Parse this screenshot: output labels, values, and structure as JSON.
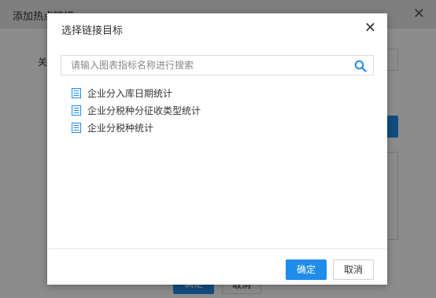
{
  "outer_dialog": {
    "title": "添加热点链接",
    "field_label": "关键",
    "confirm_label": "确定",
    "cancel_label": "取消"
  },
  "modal": {
    "title": "选择链接目标",
    "search": {
      "placeholder": "请输入图表指标名称进行搜索",
      "value": ""
    },
    "items": [
      {
        "label": "企业分入库日期统计",
        "icon": "document-icon"
      },
      {
        "label": "企业分税种分征收类型统计",
        "icon": "document-icon"
      },
      {
        "label": "企业分税种统计",
        "icon": "document-icon"
      }
    ],
    "confirm_label": "确定",
    "cancel_label": "取消"
  },
  "colors": {
    "accent": "#1f8ceb",
    "overlay": "rgba(0,0,0,0.45)"
  }
}
